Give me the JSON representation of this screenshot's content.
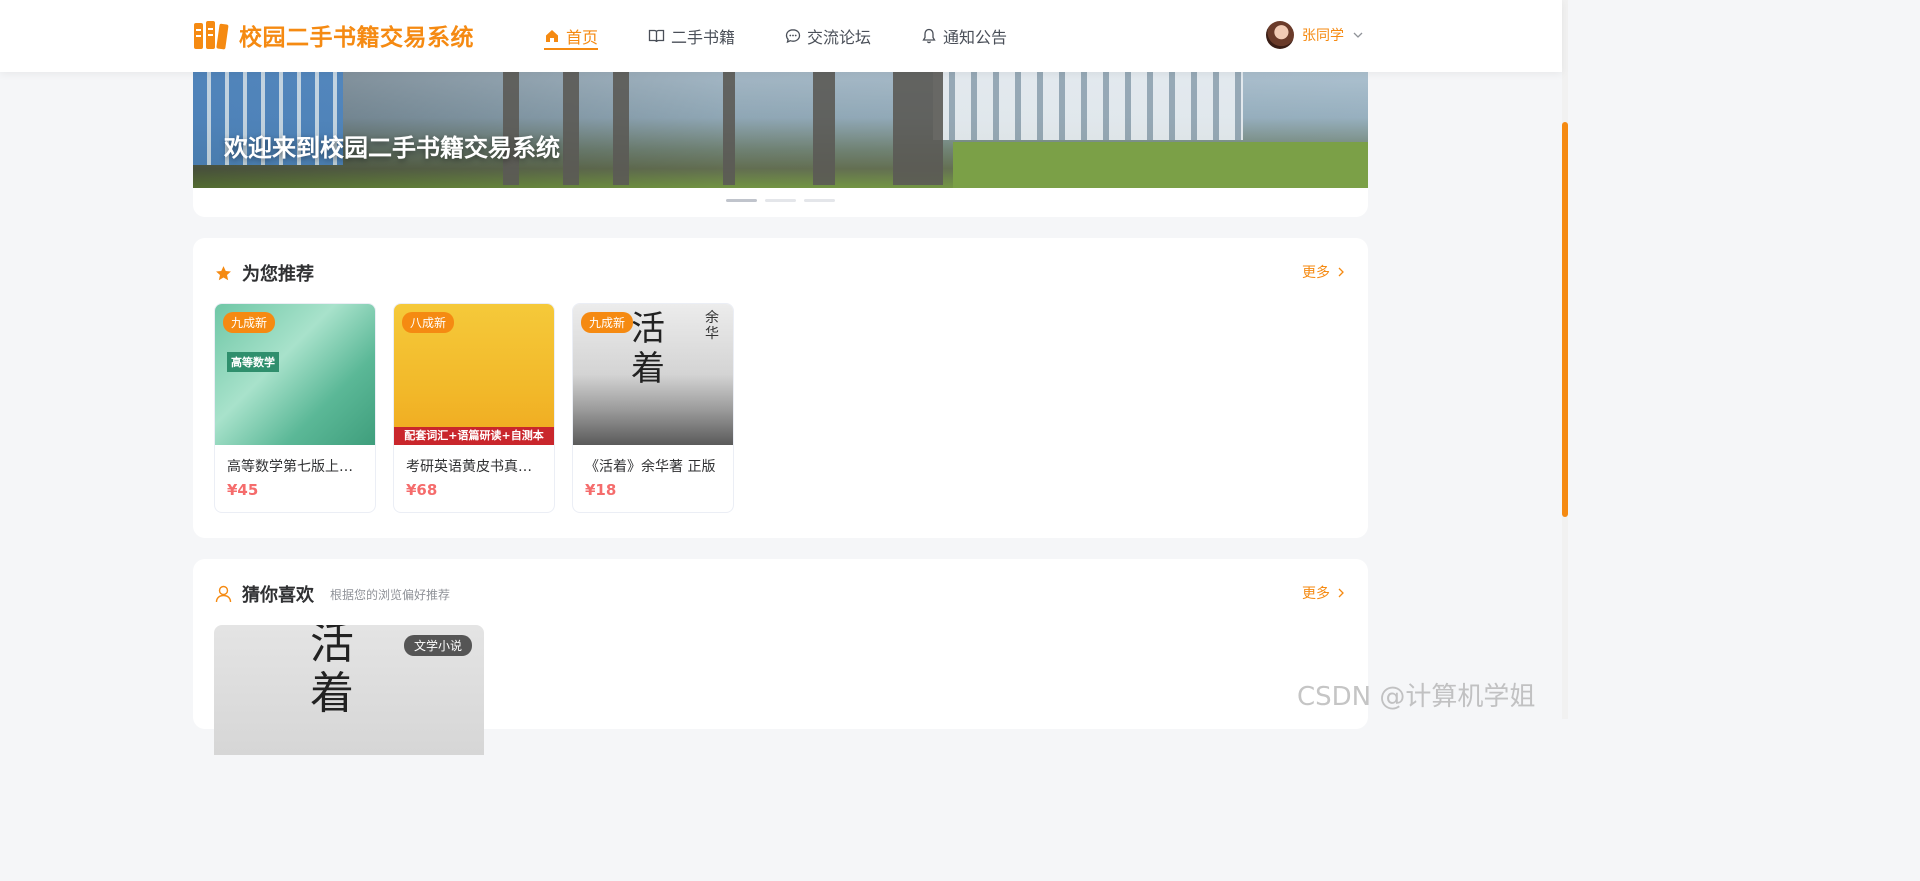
{
  "header": {
    "logo_text": "校园二手书籍交易系统",
    "nav": [
      {
        "label": "首页",
        "icon": "home-icon",
        "active": true
      },
      {
        "label": "二手书籍",
        "icon": "book-icon",
        "active": false
      },
      {
        "label": "交流论坛",
        "icon": "chat-icon",
        "active": false
      },
      {
        "label": "通知公告",
        "icon": "bell-icon",
        "active": false
      }
    ],
    "user_name": "张同学"
  },
  "banner": {
    "title": "欢迎来到校园二手书籍交易系统",
    "slides": 3,
    "active_slide": 1
  },
  "recommend": {
    "title": "为您推荐",
    "more": "更多",
    "books": [
      {
        "condition": "九成新",
        "title": "高等数学第七版上册同步辅导与习题全解",
        "price": "¥45",
        "cover_text": "高等数学"
      },
      {
        "condition": "八成新",
        "title": "考研英语黄皮书真题冲刺试卷版",
        "price": "¥68",
        "cover_text": "配套词汇+语篇研读+自测本"
      },
      {
        "condition": "九成新",
        "title": "《活着》余华著 正版",
        "price": "¥18",
        "cover_text": "活着",
        "cover_author": "余华"
      }
    ]
  },
  "guess": {
    "title": "猜你喜欢",
    "subtitle": "根据您的浏览偏好推荐",
    "more": "更多",
    "items": [
      {
        "category": "文学小说",
        "cover_text": "活着"
      }
    ]
  },
  "watermark": "CSDN @计算机学姐",
  "colors": {
    "accent": "#f58a12",
    "price": "#f56c6c"
  }
}
